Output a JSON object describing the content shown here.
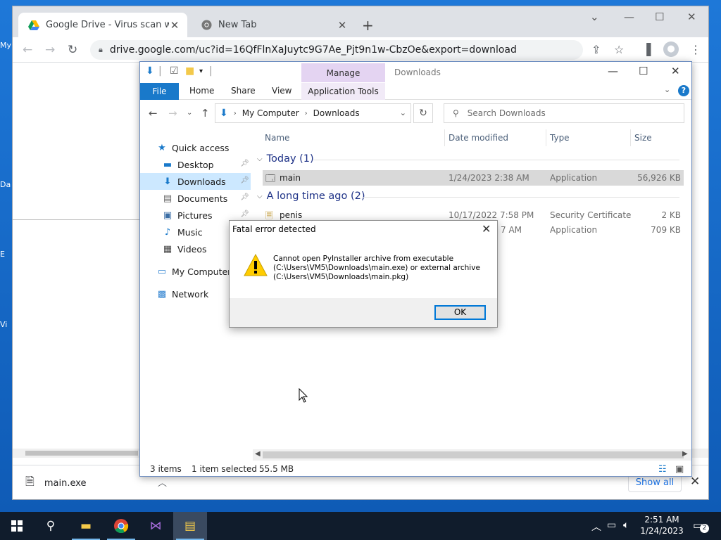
{
  "desktop": {
    "icon_labels": [
      "My",
      "Da",
      "E",
      "Vi"
    ]
  },
  "browser": {
    "tabs": [
      {
        "label": "Google Drive - Virus scan warnin",
        "close": "✕"
      },
      {
        "label": "New Tab",
        "close": "✕"
      }
    ],
    "new_tab": "+",
    "url": "drive.google.com/uc?id=16QfFlnXaJuytc9G7Ae_Pjt9n1w-CbzOe&export=download",
    "download": {
      "filename": "main.exe",
      "show_all": "Show all"
    }
  },
  "explorer": {
    "title": "Downloads",
    "context_tab": "Manage",
    "ribbon": {
      "file": "File",
      "home": "Home",
      "share": "Share",
      "view": "View",
      "app_tools": "Application Tools"
    },
    "breadcrumb": [
      "My Computer",
      "Downloads"
    ],
    "search_placeholder": "Search Downloads",
    "nav": [
      {
        "label": "Quick access",
        "icon": "star-icon",
        "glyph": "★"
      },
      {
        "label": "Desktop",
        "icon": "desktop-icon",
        "glyph": "▬",
        "pinned": true
      },
      {
        "label": "Downloads",
        "icon": "download-icon",
        "glyph": "⬇",
        "pinned": true,
        "selected": true
      },
      {
        "label": "Documents",
        "icon": "documents-icon",
        "glyph": "▤",
        "pinned": true
      },
      {
        "label": "Pictures",
        "icon": "pictures-icon",
        "glyph": "▣",
        "pinned": true
      },
      {
        "label": "Music",
        "icon": "music-icon",
        "glyph": "♪"
      },
      {
        "label": "Videos",
        "icon": "videos-icon",
        "glyph": "▦"
      },
      {
        "label": "My Computer",
        "icon": "computer-icon",
        "glyph": "▭"
      },
      {
        "label": "Network",
        "icon": "network-icon",
        "glyph": "▩"
      }
    ],
    "columns": {
      "name": "Name",
      "date": "Date modified",
      "type": "Type",
      "size": "Size"
    },
    "groups": [
      {
        "label": "Today (1)",
        "files": [
          {
            "name": "main",
            "date": "1/24/2023 2:38 AM",
            "type": "Application",
            "size": "56,926 KB",
            "selected": true
          }
        ]
      },
      {
        "label": "A long time ago (2)",
        "files": [
          {
            "name": "penis",
            "date": "10/17/2022 7:58 PM",
            "type": "Security Certificate",
            "size": "2 KB"
          },
          {
            "name": "",
            "date": "7 AM",
            "type": "Application",
            "size": "709 KB"
          }
        ]
      }
    ],
    "status": {
      "items": "3 items",
      "selected": "1 item selected",
      "size": "55.5 MB"
    }
  },
  "dialog": {
    "title": "Fatal error detected",
    "message_lines": [
      "Cannot open PyInstaller archive from executable",
      "(C:\\Users\\VM5\\Downloads\\main.exe) or external archive",
      "(C:\\Users\\VM5\\Downloads\\main.pkg)"
    ],
    "ok": "OK"
  },
  "taskbar": {
    "time": "2:51 AM",
    "date": "1/24/2023",
    "notifications": "2"
  },
  "colors": {
    "accent": "#1979ca",
    "selection": "#cce8ff",
    "manage_tab": "#e4d4f2"
  }
}
